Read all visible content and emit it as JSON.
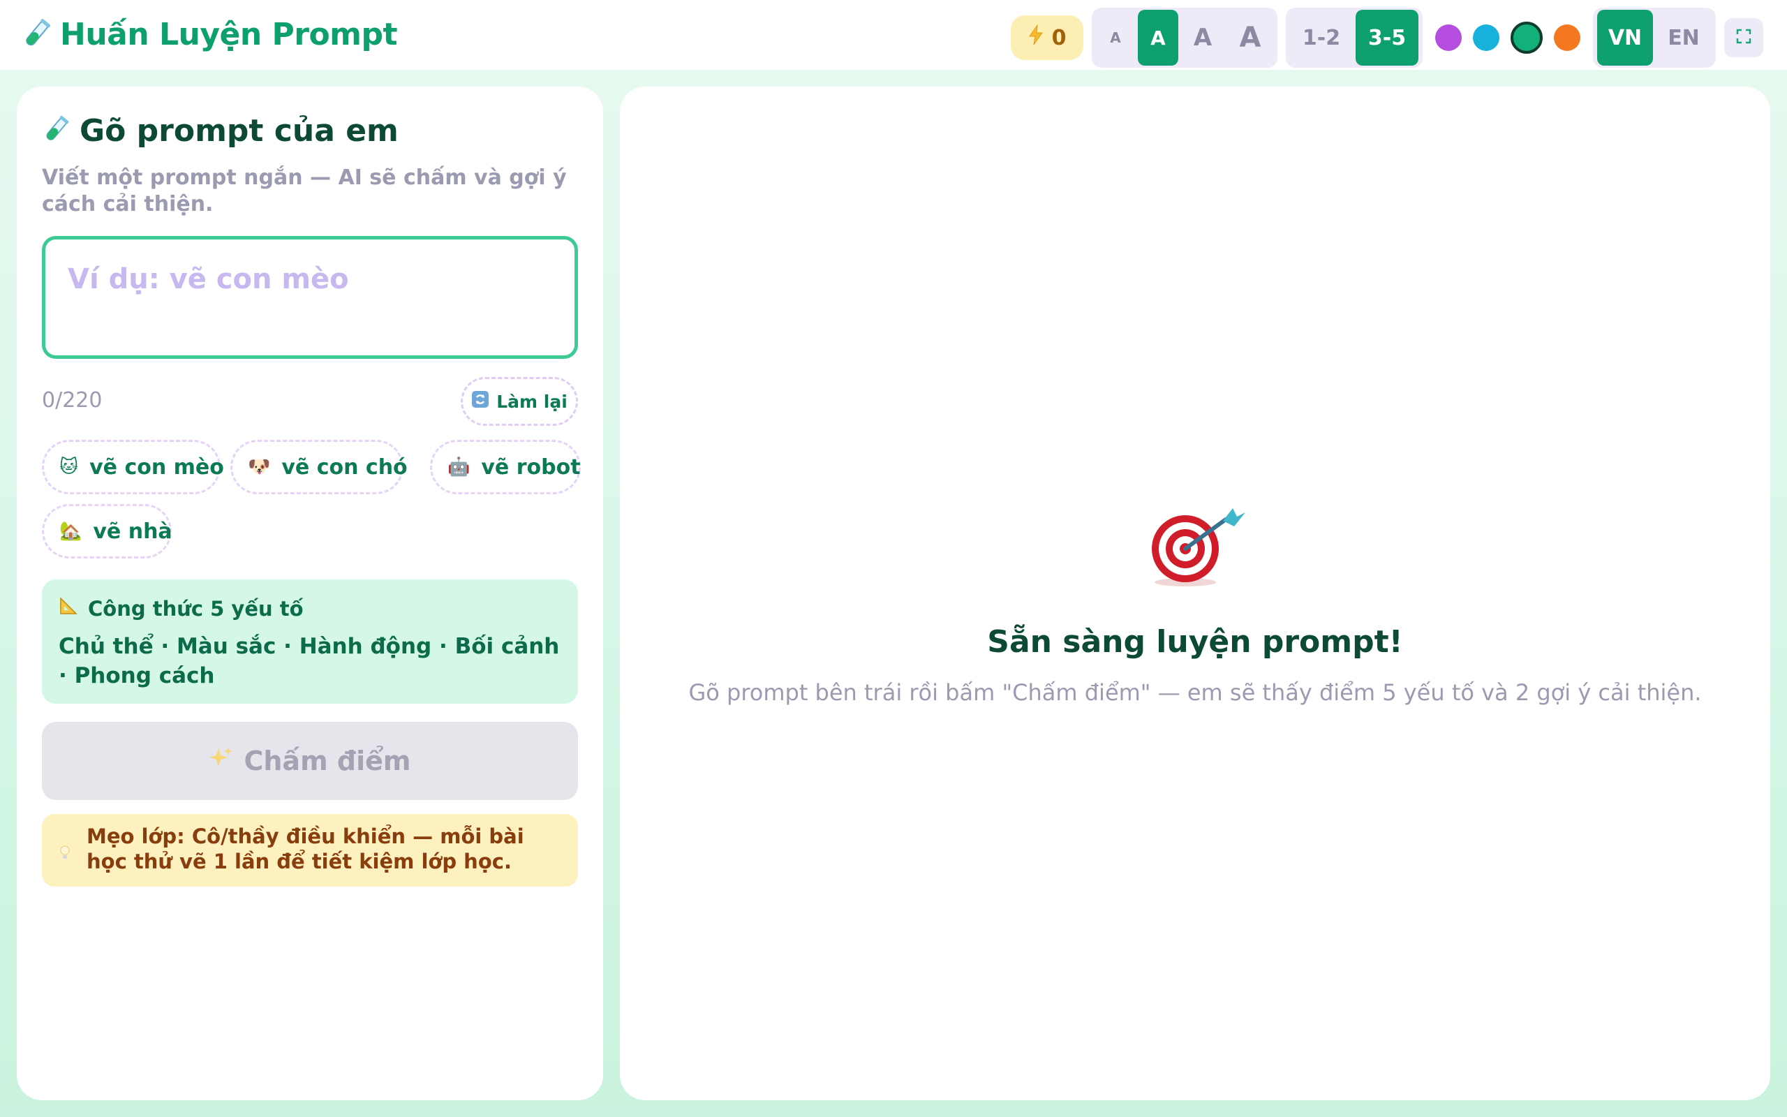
{
  "app": {
    "title": "Huấn Luyện Prompt"
  },
  "toolbar": {
    "energy_count": "0",
    "font_sizes": [
      "A",
      "A",
      "A",
      "A"
    ],
    "font_size_active_index": 1,
    "age_groups": [
      "1-2",
      "3-5"
    ],
    "age_active": "3-5",
    "themes": [
      {
        "name": "purple",
        "color": "#b44de0"
      },
      {
        "name": "cyan",
        "color": "#17b1dc"
      },
      {
        "name": "green",
        "color": "#14b07a"
      },
      {
        "name": "orange",
        "color": "#f3781f"
      }
    ],
    "theme_active": "green",
    "languages": [
      "VN",
      "EN"
    ],
    "language_active": "VN"
  },
  "left_panel": {
    "title": "Gõ prompt của em",
    "subtitle": "Viết một prompt ngắn — AI sẽ chấm và gợi ý cách cải thiện.",
    "prompt_placeholder": "Ví dụ: vẽ con mèo",
    "counter": "0/220",
    "reset_label": "Làm lại",
    "chips": [
      {
        "emoji": "🐱",
        "label": "vẽ con mèo"
      },
      {
        "emoji": "🐶",
        "label": "vẽ con chó"
      },
      {
        "emoji": "🤖",
        "label": "vẽ robot"
      },
      {
        "emoji": "🏡",
        "label": "vẽ nhà"
      }
    ],
    "formula": {
      "title": "Công thức 5 yếu tố",
      "body": "Chủ thể · Màu sắc · Hành động · Bối cảnh · Phong cách"
    },
    "score_button": "Chấm điểm",
    "tip": "Mẹo lớp: Cô/thầy điều khiển — mỗi bài học thử vẽ 1 lần để tiết kiệm lớp học."
  },
  "right_panel": {
    "ready_title": "Sẵn sàng luyện prompt!",
    "ready_subtitle": "Gõ prompt bên trái rồi bấm \"Chấm điểm\" — em sẽ thấy điểm 5 yếu tố và 2 gợi ý cải thiện."
  },
  "colors": {
    "accent": "#0e9f6e",
    "prompt_border": "#3ccb95",
    "formula_bg": "#d4f7e6",
    "tip_bg": "#fdf1c0"
  }
}
